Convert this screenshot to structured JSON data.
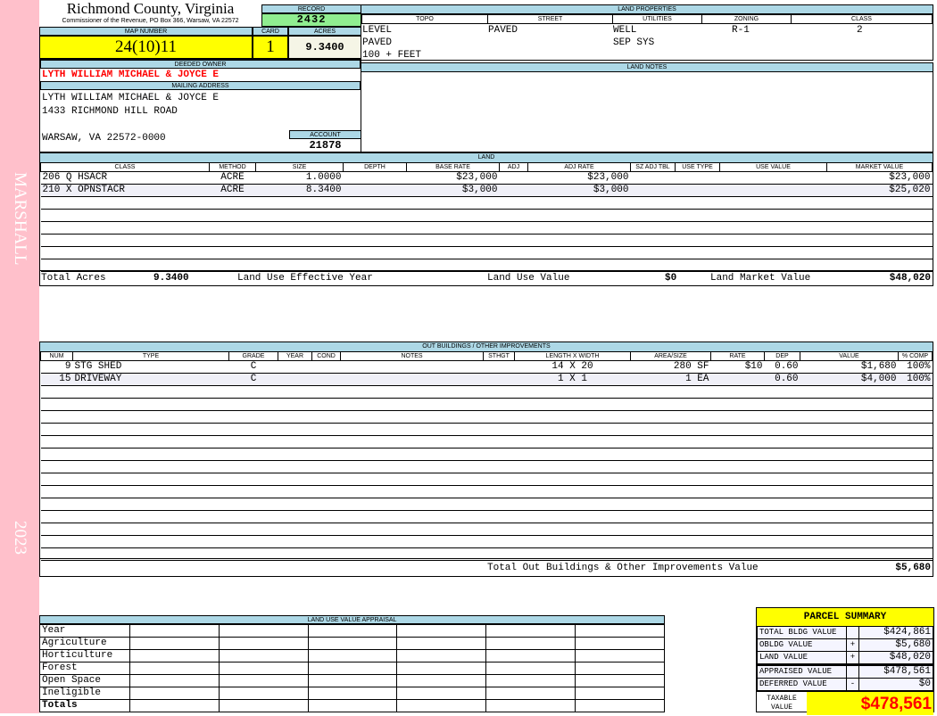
{
  "sidebar": {
    "name": "MARSHALL",
    "year": "2023",
    "color": "#ffc0cb"
  },
  "header": {
    "county": "Richmond County, Virginia",
    "subtitle": "Commissioner of the Revenue, PO Box 366, Warsaw, VA 22572",
    "record_label": "RECORD",
    "record": "2432",
    "map_label": "MAP NUMBER",
    "map": "24(10)11",
    "card_label": "CARD",
    "card": "1",
    "acres_label": "ACRES",
    "acres": "9.3400"
  },
  "land_properties": {
    "title": "LAND PROPERTIES",
    "columns": [
      "TOPO",
      "STREET",
      "UTILITIES",
      "ZONING",
      "CLASS"
    ],
    "topo": [
      "LEVEL",
      "PAVED",
      "100 + FEET"
    ],
    "street": "PAVED",
    "utilities": [
      "WELL",
      "SEP SYS"
    ],
    "zoning": "R-1",
    "class": "2"
  },
  "owner": {
    "label": "DEEDED OWNER",
    "name": "LYTH WILLIAM MICHAEL & JOYCE E",
    "mail_label": "MAILING ADDRESS",
    "mail": [
      "LYTH WILLIAM MICHAEL & JOYCE E",
      "1433 RICHMOND HILL ROAD",
      "",
      "WARSAW, VA 22572-0000"
    ],
    "account_label": "ACCOUNT",
    "account": "21878"
  },
  "land_notes": {
    "title": "LAND NOTES"
  },
  "land": {
    "title": "LAND",
    "columns": [
      "CLASS",
      "METHOD",
      "SIZE",
      "DEPTH",
      "BASE RATE",
      "ADJ",
      "ADJ RATE",
      "SZ ADJ TBL",
      "USE TYPE",
      "USE VALUE",
      "MARKET VALUE"
    ],
    "rows": [
      [
        "206 Q HSACR",
        "ACRE",
        "1.0000",
        "",
        "$23,000",
        "",
        "$23,000",
        "",
        "",
        "",
        "$23,000"
      ],
      [
        "210 X OPNSTACR",
        "ACRE",
        "8.3400",
        "",
        "$3,000",
        "",
        "$3,000",
        "",
        "",
        "",
        "$25,020"
      ]
    ],
    "totals": {
      "acres_label": "Total Acres",
      "acres": "9.3400",
      "effective_label": "Land Use Effective Year",
      "use_label": "Land Use Value",
      "use": "$0",
      "market_label": "Land Market Value",
      "market": "$48,020"
    }
  },
  "outbuildings": {
    "title": "OUT BUILDINGS / OTHER IMPROVEMENTS",
    "columns": [
      "NUM",
      "TYPE",
      "GRADE",
      "YEAR",
      "COND",
      "NOTES",
      "STHGT",
      "LENGTH X WIDTH",
      "AREA/SIZE",
      "RATE",
      "DEP",
      "VALUE",
      "% COMP"
    ],
    "rows": [
      [
        "9",
        "STG SHED",
        "C",
        "",
        "",
        "",
        "",
        "14 X 20",
        "280 SF",
        "$10",
        "0.60",
        "$1,680",
        "100%"
      ],
      [
        "15",
        "DRIVEWAY",
        "C",
        "",
        "",
        "",
        "",
        "1 X 1",
        "1 EA",
        "",
        "0.60",
        "$4,000",
        "100%"
      ]
    ],
    "total_label": "Total Out Buildings & Other Improvements Value",
    "total": "$5,680"
  },
  "land_use": {
    "title": "LAND USE VALUE APPRAISAL",
    "rows": [
      "Year",
      "Agriculture",
      "Horticulture",
      "Forest",
      "Open Space",
      "Ineligible",
      "Totals"
    ]
  },
  "parcel_summary": {
    "title": "PARCEL SUMMARY",
    "rows": [
      {
        "label": "TOTAL BLDG VALUE",
        "op": "",
        "value": "$424,861"
      },
      {
        "label": "OBLDG VALUE",
        "op": "+",
        "value": "$5,680"
      },
      {
        "label": "LAND VALUE",
        "op": "+",
        "value": "$48,020"
      },
      {
        "label": "APPRAISED VALUE",
        "op": "",
        "value": "$478,561"
      },
      {
        "label": "DEFERRED VALUE",
        "op": "-",
        "value": "$0"
      }
    ],
    "taxable_label": "TAXABLE VALUE",
    "taxable": "$478,561"
  },
  "colors": {
    "header_bg": "#add8e6",
    "highlight": "#ffff00",
    "record_bg": "#90ee90",
    "owner_text": "#ff0000"
  }
}
